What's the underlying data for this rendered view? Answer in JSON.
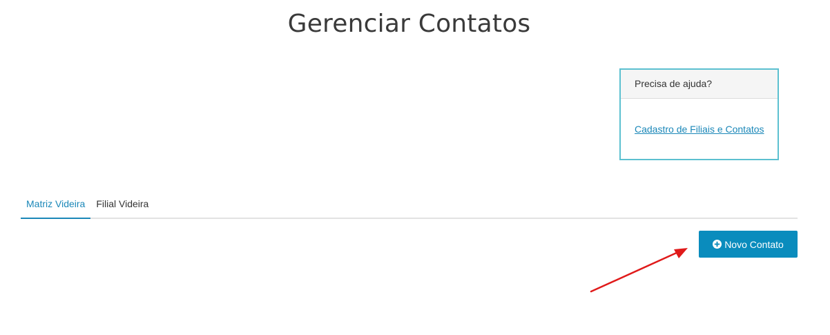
{
  "page": {
    "title": "Gerenciar Contatos"
  },
  "help_box": {
    "header": "Precisa de ajuda?",
    "link_text": "Cadastro de Filiais e Contatos"
  },
  "tabs": [
    {
      "label": "Matriz Videira",
      "active": true
    },
    {
      "label": "Filial Videira",
      "active": false
    }
  ],
  "actions": {
    "new_contact_label": "Novo Contato",
    "new_contact_icon": "plus-circle-icon"
  },
  "annotation": {
    "arrow_color": "#e01a1a"
  },
  "colors": {
    "accent": "#0a8cbd",
    "link": "#1a87b8",
    "help_border": "#5bc0d0"
  }
}
